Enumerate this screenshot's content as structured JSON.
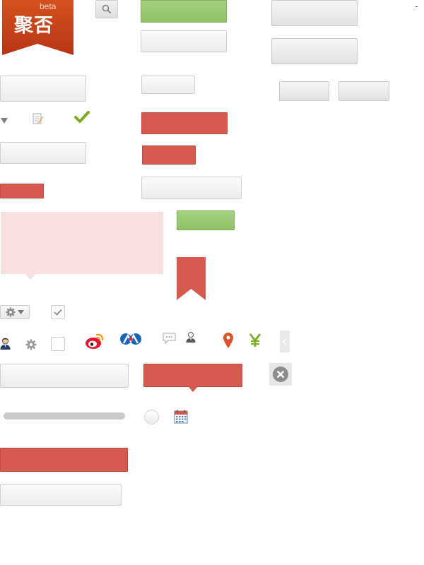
{
  "logo": {
    "text": "聚否",
    "badge": "beta"
  },
  "colors": {
    "logo_red": "#c9401f",
    "accent_red": "#d65a50",
    "accent_green": "#95c56d",
    "pink": "#f8dfe0",
    "grey": "#ececec"
  },
  "icons": {
    "search": "search-icon",
    "triangle": "triangle-down-icon",
    "edit": "edit-note-icon",
    "check": "checkmark-icon",
    "gear": "gear-icon",
    "user": "user-icon",
    "weibo": "weibo-icon",
    "renren": "renren-icon",
    "comment": "comment-bubble-icon",
    "location": "location-pin-icon",
    "yuan": "yuan-icon",
    "close": "close-icon",
    "calendar": "calendar-icon"
  }
}
